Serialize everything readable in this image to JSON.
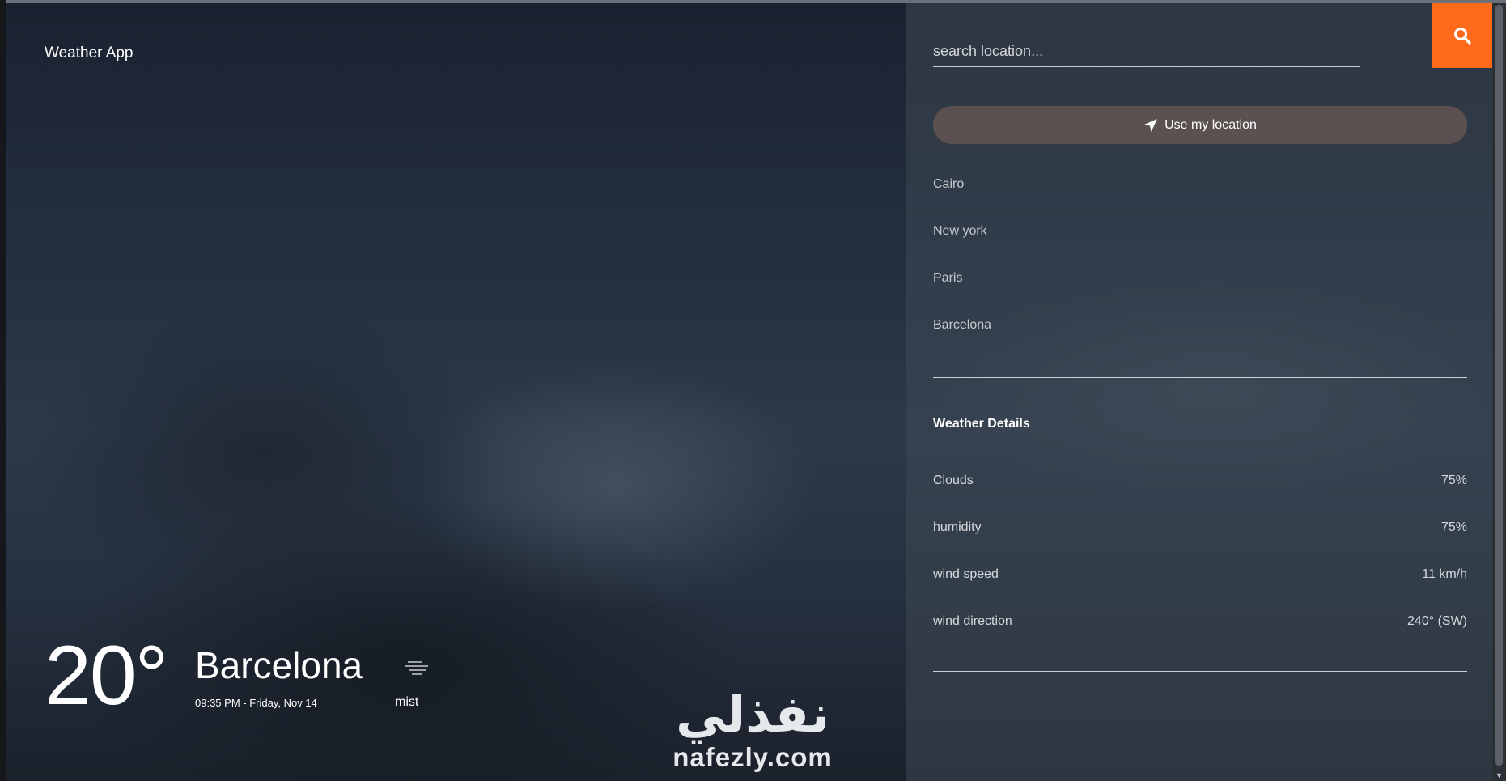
{
  "app": {
    "brand": "Weather App"
  },
  "current": {
    "temperature": "20°",
    "city": "Barcelona",
    "datetime": "09:35 PM - Friday, Nov 14",
    "condition": "mist",
    "condition_icon": "mist-icon"
  },
  "watermark": {
    "arabic": "نفذلي",
    "latin": "nafezly.com"
  },
  "search": {
    "placeholder": "search location...",
    "value": "",
    "button_icon": "search-icon",
    "button_color": "#ff6b1a"
  },
  "location_button": {
    "label": "Use my location",
    "icon": "location-arrow-icon"
  },
  "cities": [
    "Cairo",
    "New york",
    "Paris",
    "Barcelona"
  ],
  "details": {
    "title": "Weather Details",
    "rows": [
      {
        "label": "Clouds",
        "value": "75%"
      },
      {
        "label": "humidity",
        "value": "75%"
      },
      {
        "label": "wind speed",
        "value": "11 km/h"
      },
      {
        "label": "wind direction",
        "value": "240° (SW)"
      }
    ]
  }
}
